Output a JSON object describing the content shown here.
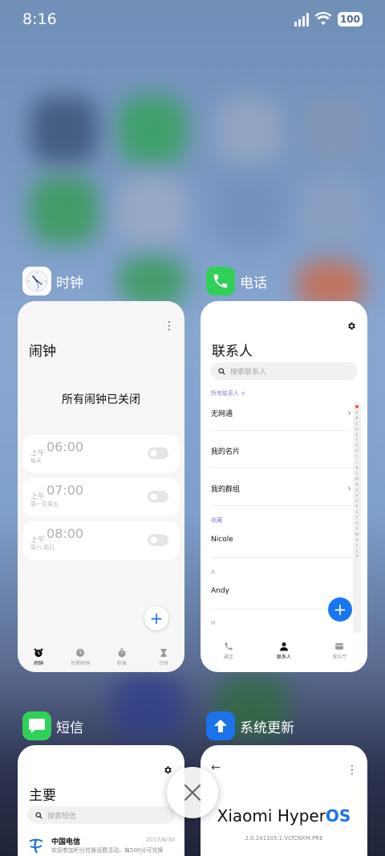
{
  "status_bar": {
    "time": "8:16",
    "battery": "100",
    "icons": [
      "signal-icon",
      "wifi-icon",
      "battery-icon"
    ]
  },
  "colors": {
    "accent": "#1976f2",
    "phone_green": "#2fd158",
    "sms_green": "#2fd158",
    "update_blue": "#1a73e8",
    "section_purple": "#8a7ad6",
    "favorite_red": "#ff3b30"
  },
  "recent_apps": {
    "clock": {
      "name": "时钟",
      "screen_title": "闹钟",
      "empty_message": "所有闹钟已关闭",
      "alarms": [
        {
          "period": "上午",
          "time": "06:00",
          "repeat": "每天",
          "enabled": false
        },
        {
          "period": "上午",
          "time": "07:00",
          "repeat": "周一至周五",
          "enabled": false
        },
        {
          "period": "上午",
          "time": "08:00",
          "repeat": "周六 周日",
          "enabled": false
        }
      ],
      "tabs": [
        "闹钟",
        "世界时钟",
        "秒表",
        "计时"
      ],
      "active_tab": "闹钟"
    },
    "phone": {
      "name": "电话",
      "screen_title": "联系人",
      "search_placeholder": "搜索联系人",
      "filter_label": "所有联系人 ≎",
      "rows": [
        {
          "label": "无网通",
          "has_chevron": true
        },
        {
          "label": "我的名片",
          "has_chevron": false
        },
        {
          "label": "我的群组",
          "has_chevron": true
        }
      ],
      "favorites_header": "收藏",
      "favorites": [
        "Nicole"
      ],
      "sections": [
        {
          "letter": "A",
          "contacts": [
            "Andy"
          ]
        },
        {
          "letter": "H",
          "contacts": []
        }
      ],
      "index_letters": [
        "♥",
        "A",
        "B",
        "C",
        "D",
        "E",
        "F",
        "G",
        "H",
        "I",
        "J",
        "K",
        "L",
        "M",
        "N",
        "O",
        "P",
        "Q",
        "R",
        "S",
        "T",
        "U",
        "V",
        "W",
        "X",
        "Y",
        "Z",
        "#"
      ],
      "tabs": [
        "通话",
        "联系人",
        "营业厅"
      ],
      "active_tab": "联系人"
    },
    "messages": {
      "name": "短信",
      "screen_title": "主要",
      "search_placeholder": "搜索短信",
      "conversations": [
        {
          "sender": "中国电信",
          "date": "2017/6/30",
          "preview": "欢迎参加积分兑换话费活动，每500分可兑换"
        }
      ]
    },
    "system_update": {
      "name": "系统更新",
      "os_name": "Xiaomi Hyper",
      "os_suffix": "OS",
      "version": "2.0.241105.1.VLTCNXM.PRE"
    }
  }
}
